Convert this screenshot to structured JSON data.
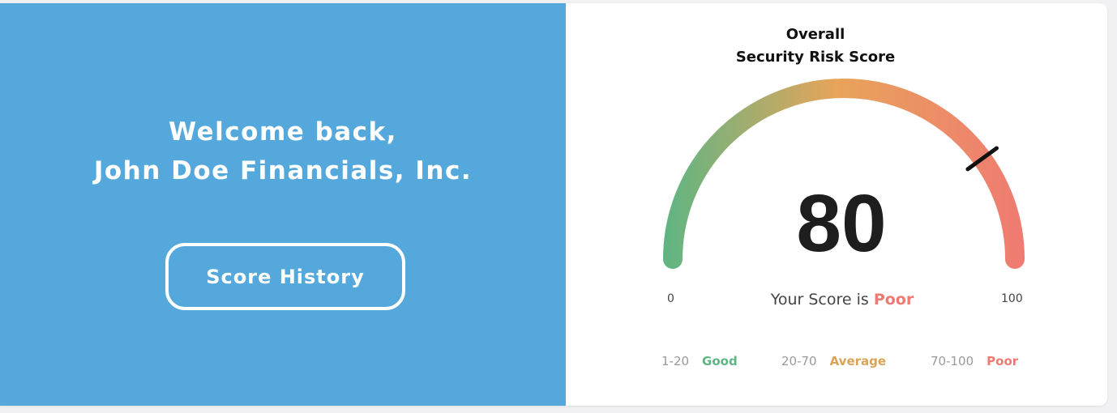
{
  "welcome": {
    "line1": "Welcome back,",
    "line2": "John Doe Financials, Inc."
  },
  "score_history_button": "Score History",
  "gauge": {
    "title_line1": "Overall",
    "title_line2": "Security Risk Score",
    "score": 80,
    "score_display": "80",
    "min_label": "0",
    "max_label": "100",
    "status_prefix": "Your Score is ",
    "status_word": "Poor",
    "colors": {
      "good": "#5db583",
      "average": "#e8a45a",
      "poor": "#ef7a72"
    }
  },
  "legend": [
    {
      "range": "1-20",
      "label": "Good",
      "color": "#5db583"
    },
    {
      "range": "20-70",
      "label": "Average",
      "color": "#d9a455"
    },
    {
      "range": "70-100",
      "label": "Poor",
      "color": "#ef7a72"
    }
  ],
  "colors": {
    "left_panel": "#54a8dc",
    "card_background": "#ffffff",
    "page_background": "#f1f1f3"
  }
}
